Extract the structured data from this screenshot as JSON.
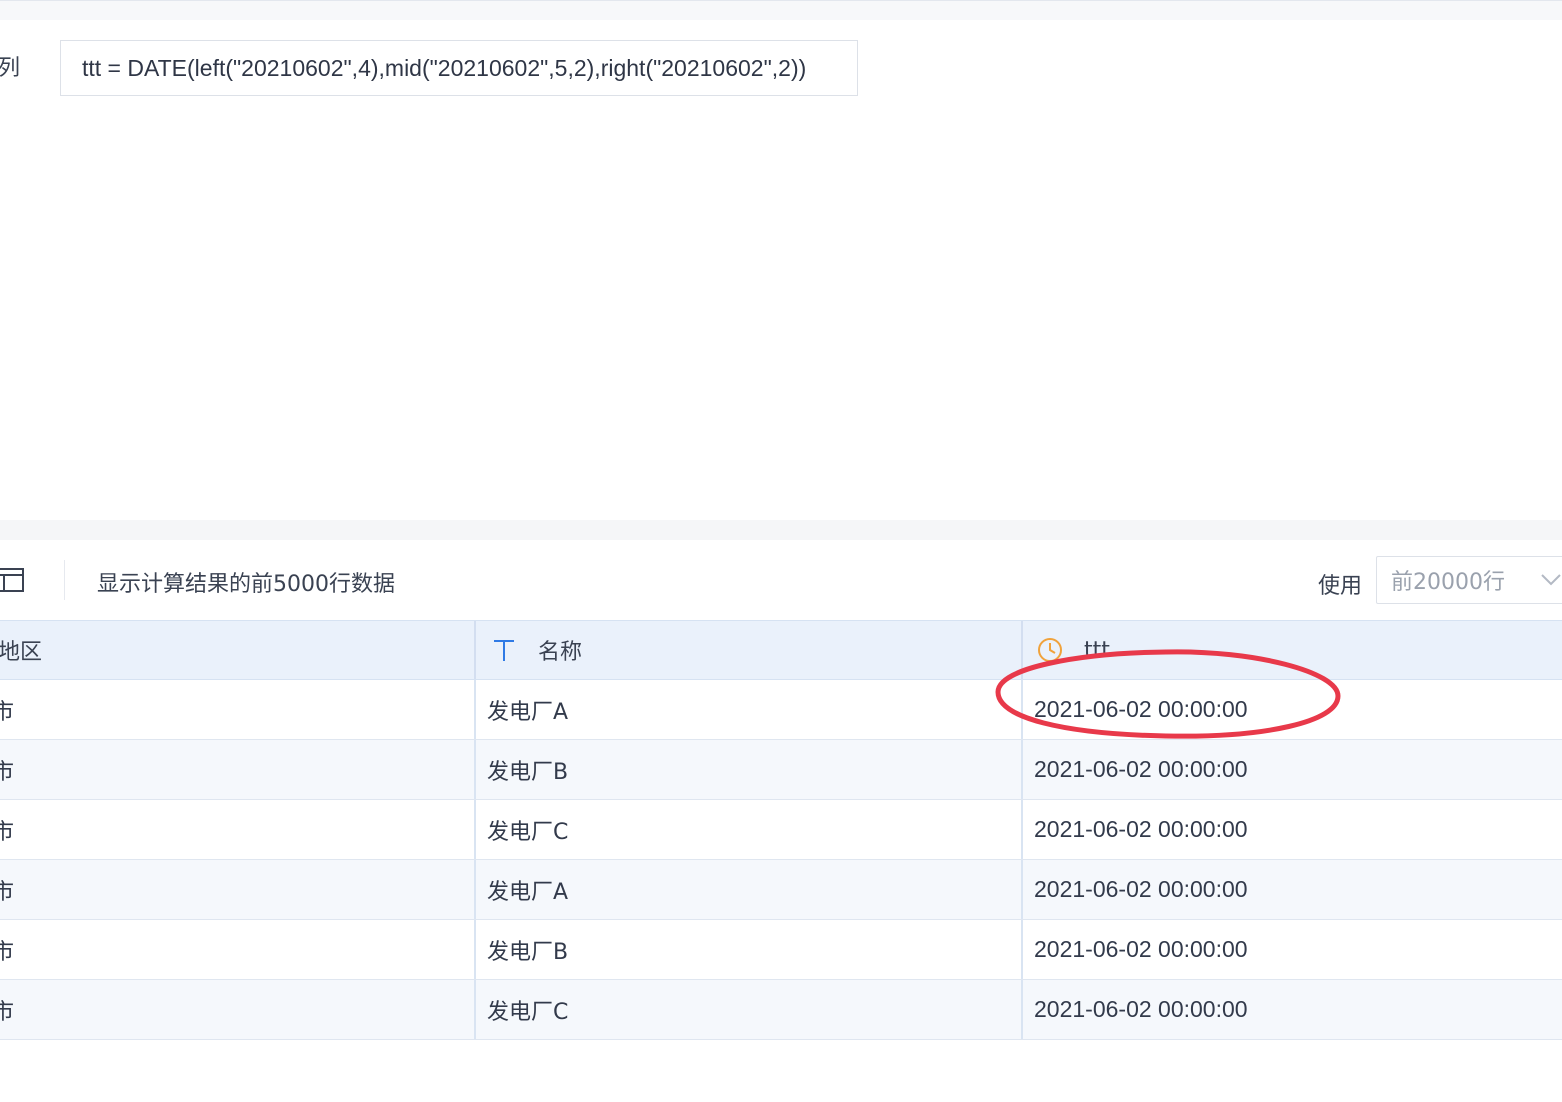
{
  "formula": {
    "label": "列",
    "expression": "ttt = DATE(left(\"20210602\",4),mid(\"20210602\",5,2),right(\"20210602\",2))"
  },
  "toolbar": {
    "info_text": "显示计算结果的前5000行数据",
    "use_label": "使用",
    "rows_select_value": "前20000行"
  },
  "table": {
    "columns": [
      {
        "label": "地区",
        "icon": ""
      },
      {
        "label": "名称",
        "icon": "text-type-icon"
      },
      {
        "label": "ttt",
        "icon": "clock-icon"
      }
    ],
    "rows": [
      {
        "region": "市",
        "name": "发电厂A",
        "ttt": "2021-06-02 00:00:00"
      },
      {
        "region": "市",
        "name": "发电厂B",
        "ttt": "2021-06-02 00:00:00"
      },
      {
        "region": "市",
        "name": "发电厂C",
        "ttt": "2021-06-02 00:00:00"
      },
      {
        "region": "市",
        "name": "发电厂A",
        "ttt": "2021-06-02 00:00:00"
      },
      {
        "region": "市",
        "name": "发电厂B",
        "ttt": "2021-06-02 00:00:00"
      },
      {
        "region": "市",
        "name": "发电厂C",
        "ttt": "2021-06-02 00:00:00"
      }
    ]
  },
  "colors": {
    "accent_blue": "#2f7ae5",
    "clock_orange": "#f0a23b",
    "annotation_red": "#e8394a",
    "header_bg": "#eaf1fb"
  }
}
